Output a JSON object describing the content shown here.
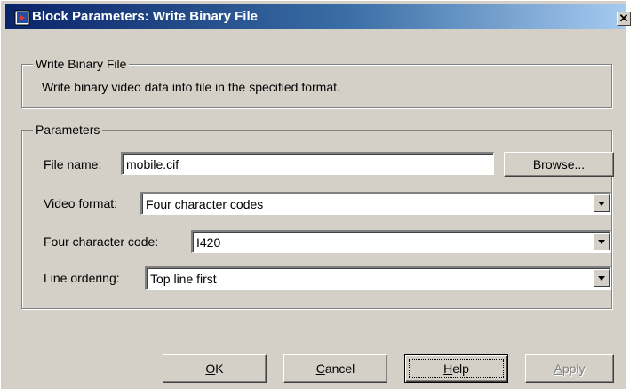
{
  "window": {
    "title": "Block Parameters: Write Binary File",
    "close_glyph": "✕"
  },
  "description_group": {
    "legend": "Write Binary File",
    "text": "Write binary video data into file in the specified format."
  },
  "parameters": {
    "legend": "Parameters",
    "file_name": {
      "label": "File name:",
      "value": "mobile.cif"
    },
    "browse_label": "Browse...",
    "video_format": {
      "label": "Video format:",
      "value": "Four character codes"
    },
    "four_cc": {
      "label": "Four character code:",
      "value": "I420"
    },
    "line_ordering": {
      "label": "Line ordering:",
      "value": "Top line first"
    }
  },
  "buttons": {
    "ok": {
      "mnemonic": "O",
      "rest": "K"
    },
    "cancel": {
      "mnemonic": "C",
      "rest": "ancel"
    },
    "help": {
      "mnemonic": "H",
      "rest": "elp"
    },
    "apply": {
      "mnemonic": "A",
      "rest": "pply"
    }
  },
  "colors": {
    "face": "#d4d0c8",
    "title_gradient_start": "#0a246a",
    "title_gradient_end": "#a6caf0",
    "disabled_text": "#808080"
  }
}
